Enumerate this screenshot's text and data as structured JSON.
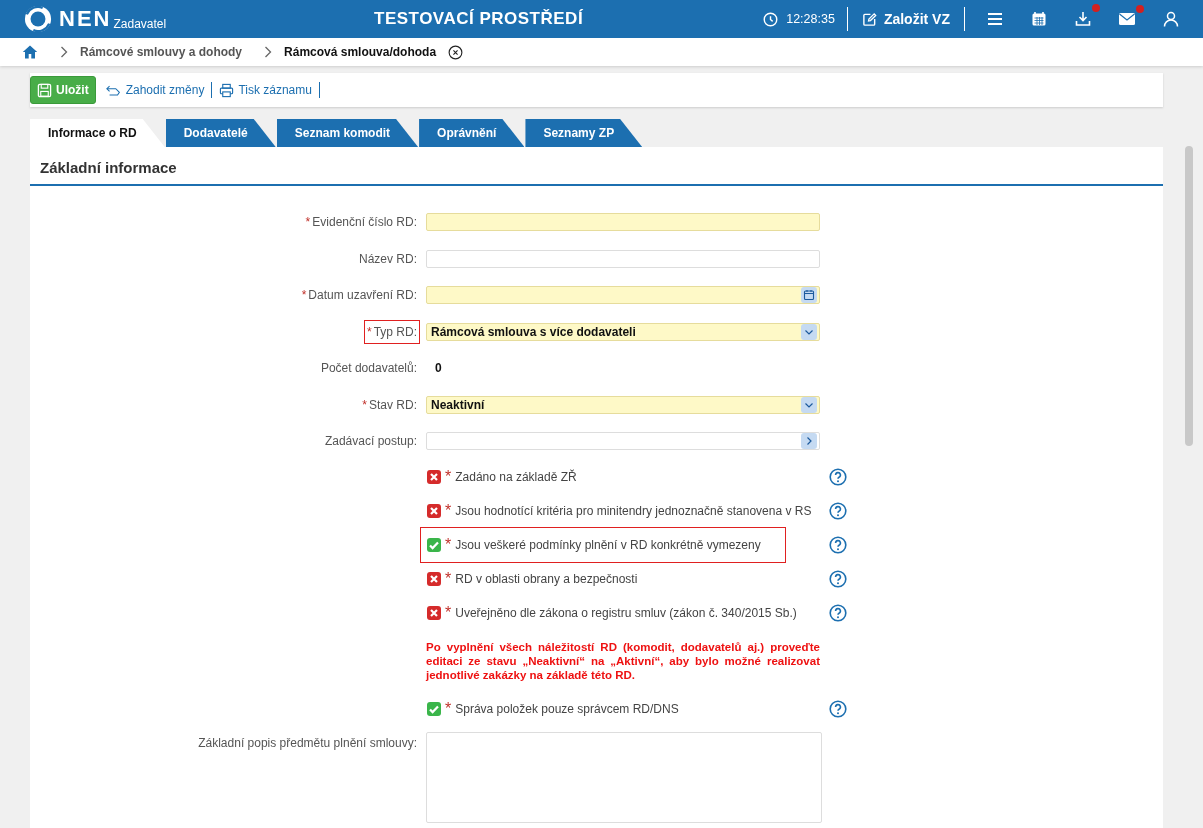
{
  "header": {
    "logo_text": "NEN",
    "logo_subtitle": "Zadavatel",
    "environment": "TESTOVACÍ PROSTŘEDÍ",
    "time": "12:28:35",
    "create_button": "Založit VZ",
    "icons": [
      {
        "kind": "menu"
      },
      {
        "kind": "calendar"
      },
      {
        "kind": "download",
        "badge": true
      },
      {
        "kind": "mail",
        "badge": true
      },
      {
        "kind": "user"
      }
    ]
  },
  "breadcrumb": {
    "items": [
      {
        "label": "Rámcové smlouvy a dohody",
        "current": false
      },
      {
        "label": "Rámcová smlouva/dohoda",
        "current": true
      }
    ]
  },
  "toolbar": {
    "save": "Uložit",
    "discard": "Zahodit změny",
    "print": "Tisk záznamu"
  },
  "tabs": [
    {
      "label": "Informace o RD",
      "selected": true
    },
    {
      "label": "Dodavatelé",
      "selected": false
    },
    {
      "label": "Seznam komodit",
      "selected": false
    },
    {
      "label": "Oprávnění",
      "selected": false
    },
    {
      "label": "Seznamy ZP",
      "selected": false
    }
  ],
  "section": {
    "title": "Základní informace"
  },
  "fields": [
    {
      "kind": "text",
      "marker": "*",
      "label": "Evidenční číslo RD:",
      "required": true,
      "highlighted": false
    },
    {
      "kind": "text",
      "label": "Název RD:",
      "required": false,
      "highlighted": false
    },
    {
      "kind": "date",
      "marker": "*",
      "label": "Datum uzavření RD:",
      "required": true,
      "highlighted": false
    },
    {
      "kind": "select",
      "marker": "*",
      "label": "Typ RD:",
      "required": true,
      "highlighted": true,
      "value": "Rámcová smlouva s více dodavateli"
    },
    {
      "kind": "display",
      "label": "Počet dodavatelů:",
      "highlighted": false,
      "value": "0"
    },
    {
      "kind": "select",
      "marker": "*",
      "label": "Stav RD:",
      "required": true,
      "highlighted": false,
      "value": "Neaktivní"
    },
    {
      "kind": "lookup",
      "label": "Zadávací postup:",
      "required": false,
      "highlighted": false
    }
  ],
  "checks": [
    {
      "marker": "*",
      "label": "Zadáno na základě ZŘ",
      "yes": false,
      "highlighted": false
    },
    {
      "marker": "*",
      "label": "Jsou hodnotící kritéria pro minitendry jednoznačně stanovena v RS",
      "yes": false,
      "highlighted": false
    },
    {
      "marker": "*",
      "label": "Jsou veškeré podmínky plnění v RD konkrétně vymezeny",
      "yes": true,
      "highlighted": true
    },
    {
      "marker": "*",
      "label": "RD v oblasti obrany a bezpečnosti",
      "yes": false,
      "highlighted": false
    },
    {
      "marker": "*",
      "label": "Uveřejněno dle zákona o registru smluv (zákon č. 340/2015 Sb.)",
      "yes": false,
      "highlighted": false
    }
  ],
  "notice": "Po vyplnění všech náležitostí RD (komodit, dodavatelů aj.) proveďte editaci ze stavu „Neaktivní“ na „Aktivní“, aby bylo možné realizovat jednotlivé zakázky na základě této RD.",
  "checks_after": [
    {
      "marker": "*",
      "label": "Správa položek pouze správcem RD/DNS",
      "yes": true,
      "highlighted": false
    }
  ],
  "description": {
    "label": "Základní popis předmětu plnění smlouvy:"
  }
}
